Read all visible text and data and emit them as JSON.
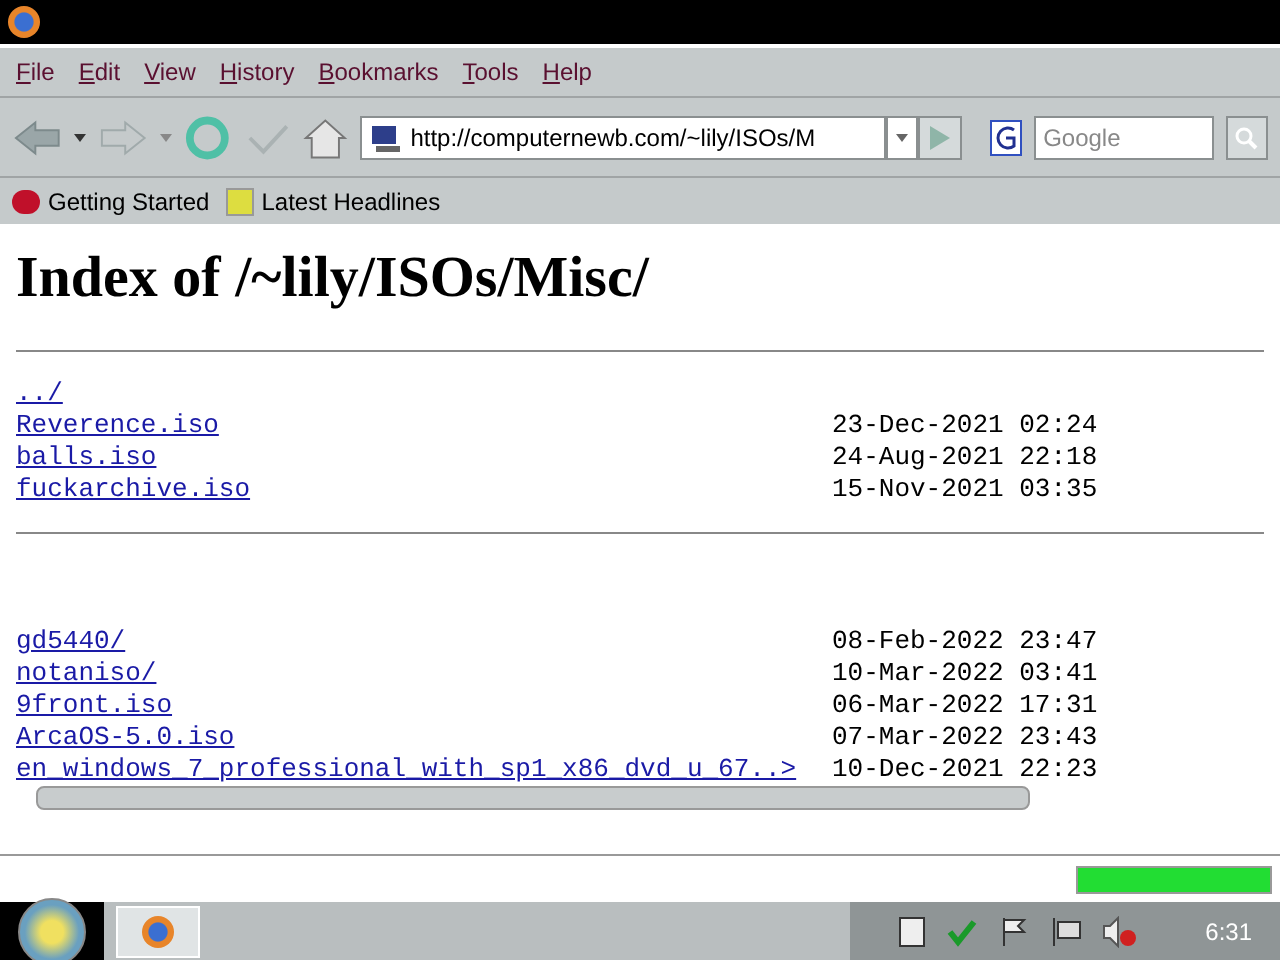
{
  "menu": [
    {
      "label": "File"
    },
    {
      "label": "Edit"
    },
    {
      "label": "View"
    },
    {
      "label": "History"
    },
    {
      "label": "Bookmarks"
    },
    {
      "label": "Tools"
    },
    {
      "label": "Help"
    }
  ],
  "address": {
    "value": "http://computernewb.com/~lily/ISOs/M"
  },
  "search": {
    "placeholder": "Google"
  },
  "bookmarks": [
    "Getting Started",
    "Latest Headlines"
  ],
  "page": {
    "heading": "Index of /~lily/ISOs/Misc/",
    "parent": "../",
    "entries": [
      {
        "name": "Reverence.iso",
        "date": "23-Dec-2021 02:24"
      },
      {
        "name": "balls.iso",
        "date": "24-Aug-2021 22:18"
      },
      {
        "name": "fuckarchive.iso",
        "date": "15-Nov-2021 03:35"
      }
    ],
    "entries_lower": [
      {
        "name": "gd5440/",
        "date": "08-Feb-2022 23:47"
      },
      {
        "name": "notaniso/",
        "date": "10-Mar-2022 03:41"
      },
      {
        "name": "9front.iso",
        "date": "06-Mar-2022 17:31"
      },
      {
        "name": "ArcaOS-5.0.iso",
        "date": "07-Mar-2022 23:43"
      },
      {
        "name": "en_windows_7_professional_with_sp1_x86_dvd_u_67..>",
        "date": "10-Dec-2021 22:23"
      }
    ]
  },
  "status_bar": {
    "level": 1
  },
  "taskbar": {
    "clock": "6:31"
  }
}
